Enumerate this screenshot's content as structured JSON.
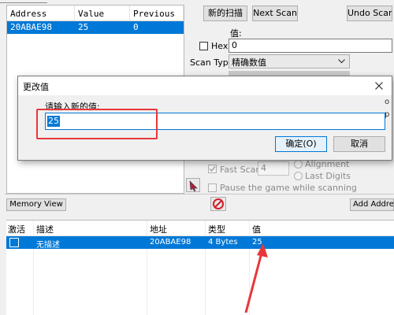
{
  "found_list": {
    "headers": {
      "address": "Address",
      "value": "Value",
      "previous": "Previous"
    },
    "rows": [
      {
        "address": "20ABAE98",
        "value": "25",
        "previous": "0"
      }
    ]
  },
  "scan": {
    "new_scan": "新的扫描",
    "next_scan": "Next Scan",
    "undo_scan": "Undo Scan",
    "value_label": "值:",
    "hex_label": "Hex",
    "value_input": "0",
    "scan_type_label": "Scan Type",
    "scan_type_value": "精确数值",
    "fast_scan_label": "Fast Scan",
    "fast_scan_value": "4",
    "alignment_label": "Alignment",
    "last_digits_label": "Last Digits",
    "pause_label": "Pause the game while scanning"
  },
  "toolbar": {
    "memory_view": "Memory View",
    "add_address": "Add Address Manually"
  },
  "dialog": {
    "title": "更改值",
    "prompt": "请输入新的值:",
    "input_value": "25",
    "ok": "确定(O)",
    "cancel": "取消"
  },
  "address_list": {
    "headers": {
      "active": "激活",
      "description": "描述",
      "address": "地址",
      "type": "类型",
      "value": "值"
    },
    "rows": [
      {
        "description": "无描述",
        "address": "20ABAE98",
        "type": "4 Bytes",
        "value": "25"
      }
    ]
  },
  "colors": {
    "selection": "#0078d7",
    "annotation": "#e8373a"
  }
}
